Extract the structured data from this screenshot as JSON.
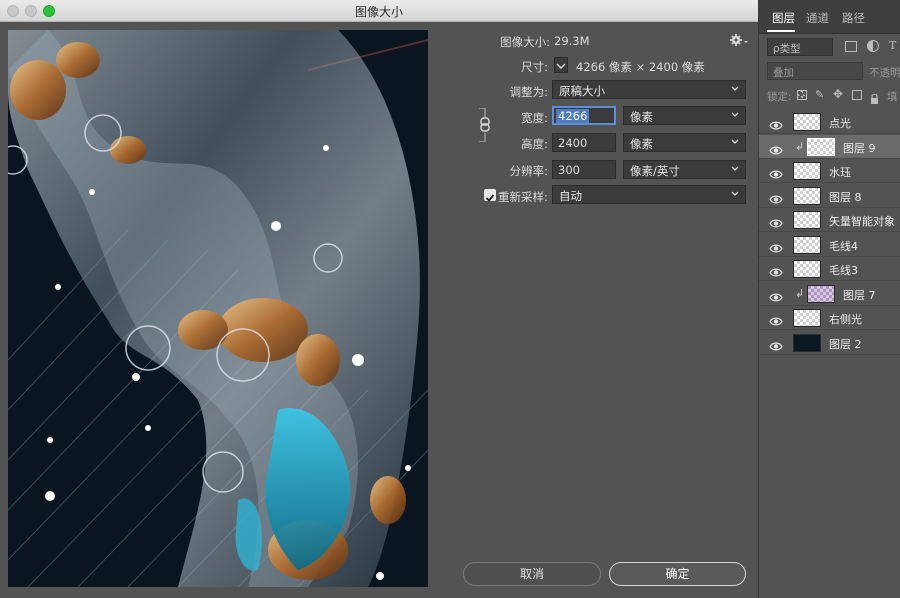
{
  "window": {
    "title": "图像大小"
  },
  "dialog": {
    "image_size_label": "图像大小:",
    "image_size_value": "29.3M",
    "dimensions_label": "尺寸:",
    "dimensions_value": "4266 像素 × 2400 像素",
    "fit_to_label": "调整为:",
    "fit_to_value": "原稿大小",
    "width_label": "宽度:",
    "width_value": "4266",
    "width_unit": "像素",
    "height_label": "高度:",
    "height_value": "2400",
    "height_unit": "像素",
    "resolution_label": "分辨率:",
    "resolution_value": "300",
    "resolution_unit": "像素/英寸",
    "resample_label": "重新采样:",
    "resample_checked": true,
    "resample_value": "自动",
    "cancel_label": "取消",
    "ok_label": "确定",
    "accent_color": "#2d6fe0"
  },
  "panel": {
    "tabs": [
      "图层",
      "通道",
      "路径"
    ],
    "active_tab": "图层",
    "filter_label": "ρ类型",
    "blend_mode": "叠加",
    "opacity_label": "不透明",
    "lock_label": "锁定:",
    "fill_label": "填",
    "layers": [
      {
        "name": "点光",
        "clipped": false,
        "selected": false,
        "thumb": "transparent"
      },
      {
        "name": "图层 9",
        "clipped": true,
        "selected": true,
        "thumb": "transparent"
      },
      {
        "name": "水珏",
        "clipped": false,
        "selected": false,
        "thumb": "transparent"
      },
      {
        "name": "图层 8",
        "clipped": false,
        "selected": false,
        "thumb": "transparent"
      },
      {
        "name": "矢量智能对象",
        "clipped": false,
        "selected": false,
        "thumb": "transparent"
      },
      {
        "name": "毛线4",
        "clipped": false,
        "selected": false,
        "thumb": "transparent"
      },
      {
        "name": "毛线3",
        "clipped": false,
        "selected": false,
        "thumb": "transparent"
      },
      {
        "name": "图层 7",
        "clipped": true,
        "selected": false,
        "thumb": "purple"
      },
      {
        "name": "右侧光",
        "clipped": false,
        "selected": false,
        "thumb": "transparent"
      },
      {
        "name": "图层 2",
        "clipped": false,
        "selected": false,
        "thumb": "dark"
      }
    ]
  }
}
